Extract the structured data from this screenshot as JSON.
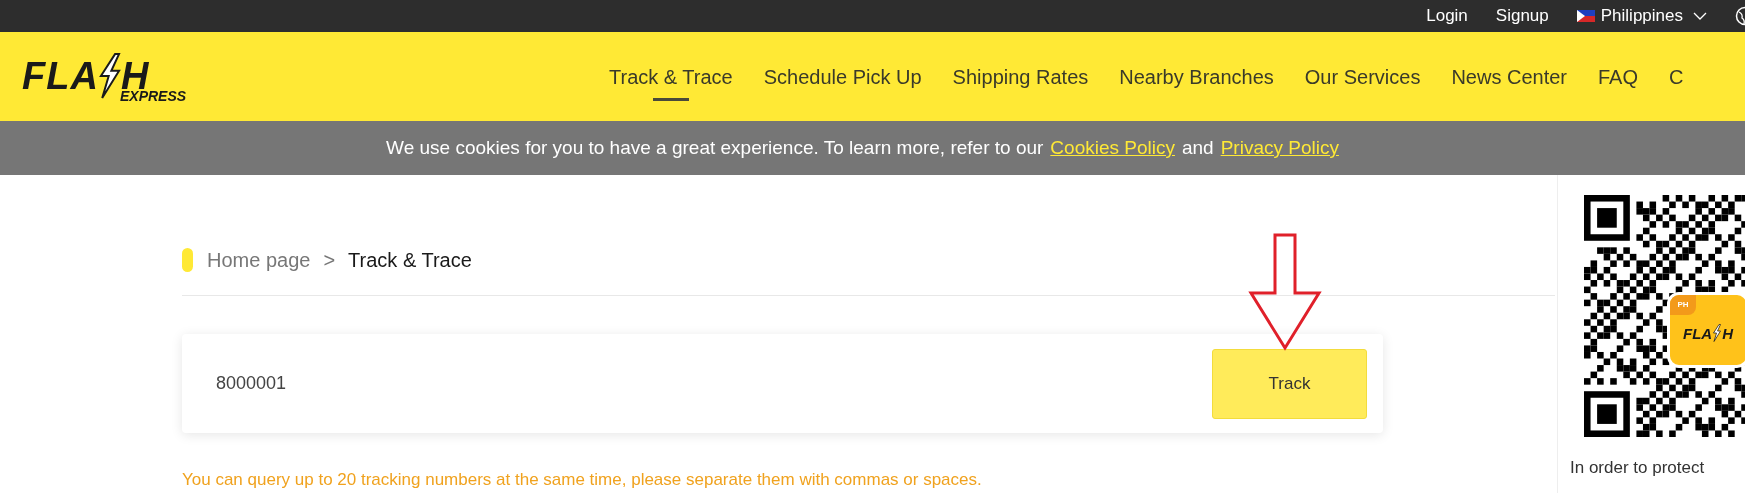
{
  "top_bar": {
    "links": [
      "Login",
      "Signup"
    ],
    "country": "Philippines"
  },
  "logo": {
    "left": "FLA",
    "right": "H",
    "sub": "EXPRESS"
  },
  "nav": [
    {
      "label": "Track & Trace",
      "selected": true
    },
    {
      "label": "Schedule Pick Up",
      "selected": false
    },
    {
      "label": "Shipping Rates",
      "selected": false
    },
    {
      "label": "Nearby Branches",
      "selected": false
    },
    {
      "label": "Our Services",
      "selected": false
    },
    {
      "label": "News Center",
      "selected": false
    },
    {
      "label": "FAQ",
      "selected": false
    },
    {
      "label": "C",
      "selected": false
    }
  ],
  "cookie_banner": {
    "text": "We use cookies for you to have a great experience. To learn more, refer to our",
    "link_1": "Cookies Policy",
    "joiner": "and",
    "link_2": "Privacy Policy"
  },
  "breadcrumb": [
    "Home page",
    ">",
    "Track & Trace"
  ],
  "search": {
    "value": "8000001",
    "button": "Track"
  },
  "hint": "You can query up to 20 tracking numbers at the same time, please separate them with commas or spaces.",
  "qr_panel": {
    "badge": "PH",
    "logo_left": "FLA",
    "logo_right": "H",
    "caption": "In order to protect"
  }
}
